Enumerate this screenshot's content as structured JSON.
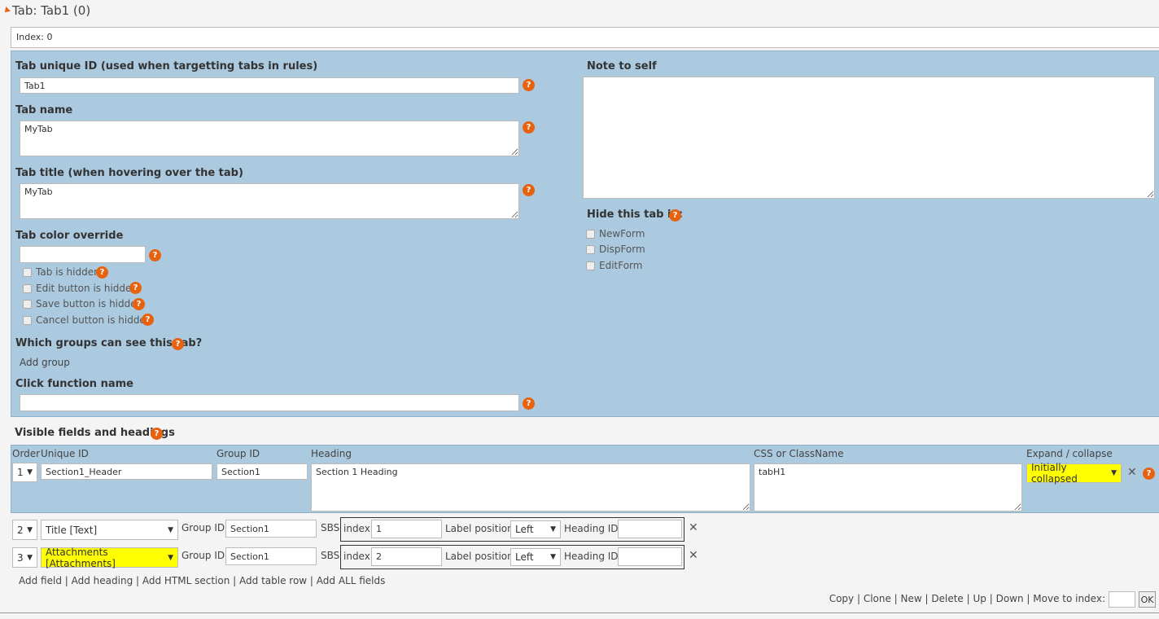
{
  "header": {
    "title": "Tab: Tab1 (0)",
    "index_label": "Index: 0"
  },
  "tab": {
    "unique_id_label": "Tab unique ID (used when targetting tabs in rules)",
    "unique_id_value": "Tab1",
    "name_label": "Tab name",
    "name_value": "MyTab",
    "title_label": "Tab title (when hovering over the tab)",
    "title_value": "MyTab",
    "color_label": "Tab color override",
    "color_value": "",
    "checkboxes": [
      {
        "label": "Tab is hidden",
        "checked": false
      },
      {
        "label": "Edit button is hidden",
        "checked": false
      },
      {
        "label": "Save button is hidden",
        "checked": false
      },
      {
        "label": "Cancel button is hidden",
        "checked": false
      }
    ],
    "groups_label": "Which groups can see this tab?",
    "add_group": "Add group",
    "click_label": "Click function name",
    "click_value": ""
  },
  "note": {
    "label": "Note to self",
    "value": ""
  },
  "hide": {
    "label": "Hide this tab in:",
    "options": [
      {
        "label": "NewForm",
        "checked": false
      },
      {
        "label": "DispForm",
        "checked": false
      },
      {
        "label": "EditForm",
        "checked": false
      }
    ]
  },
  "help_glyph": "?",
  "fields_section": {
    "title": "Visible fields and headings",
    "columns": {
      "order": "Order",
      "unique_id": "Unique ID",
      "group_id": "Group ID",
      "heading": "Heading",
      "css": "CSS or ClassName",
      "expand": "Expand / collapse"
    },
    "heading_row": {
      "order": "1",
      "unique_id": "Section1_Header",
      "group_id": "Section1",
      "heading": "Section 1 Heading",
      "css": "tabH1",
      "expand": "Initially collapsed"
    },
    "field_rows": [
      {
        "order": "2",
        "field": "Title [Text]",
        "group_label": "Group ID:",
        "group_id": "Section1",
        "sbs_label": "SBS:",
        "index_label": "index:",
        "index": "1",
        "label_pos_label": "Label position:",
        "label_pos": "Left",
        "heading_id_label": "Heading ID:",
        "heading_id": ""
      },
      {
        "order": "3",
        "field": "Attachments [Attachments]",
        "group_label": "Group ID:",
        "group_id": "Section1",
        "sbs_label": "SBS:",
        "index_label": "index:",
        "index": "2",
        "label_pos_label": "Label position:",
        "label_pos": "Left",
        "heading_id_label": "Heading ID:",
        "heading_id": ""
      }
    ],
    "add_links": [
      "Add field",
      "Add heading",
      "Add HTML section",
      "Add table row",
      "Add ALL fields"
    ]
  },
  "footer": {
    "actions": [
      "Copy",
      "Clone",
      "New",
      "Delete",
      "Up",
      "Down"
    ],
    "move_label": "Move to index:",
    "move_value": "",
    "ok": "OK"
  },
  "icons": {
    "close": "close-icon",
    "dropdown": "dropdown-arrow-icon",
    "help": "help-icon",
    "collapse": "collapse-triangle-icon"
  },
  "colors": {
    "panel": "#abc9df",
    "help": "#e8610e",
    "highlight": "#fffe00"
  }
}
